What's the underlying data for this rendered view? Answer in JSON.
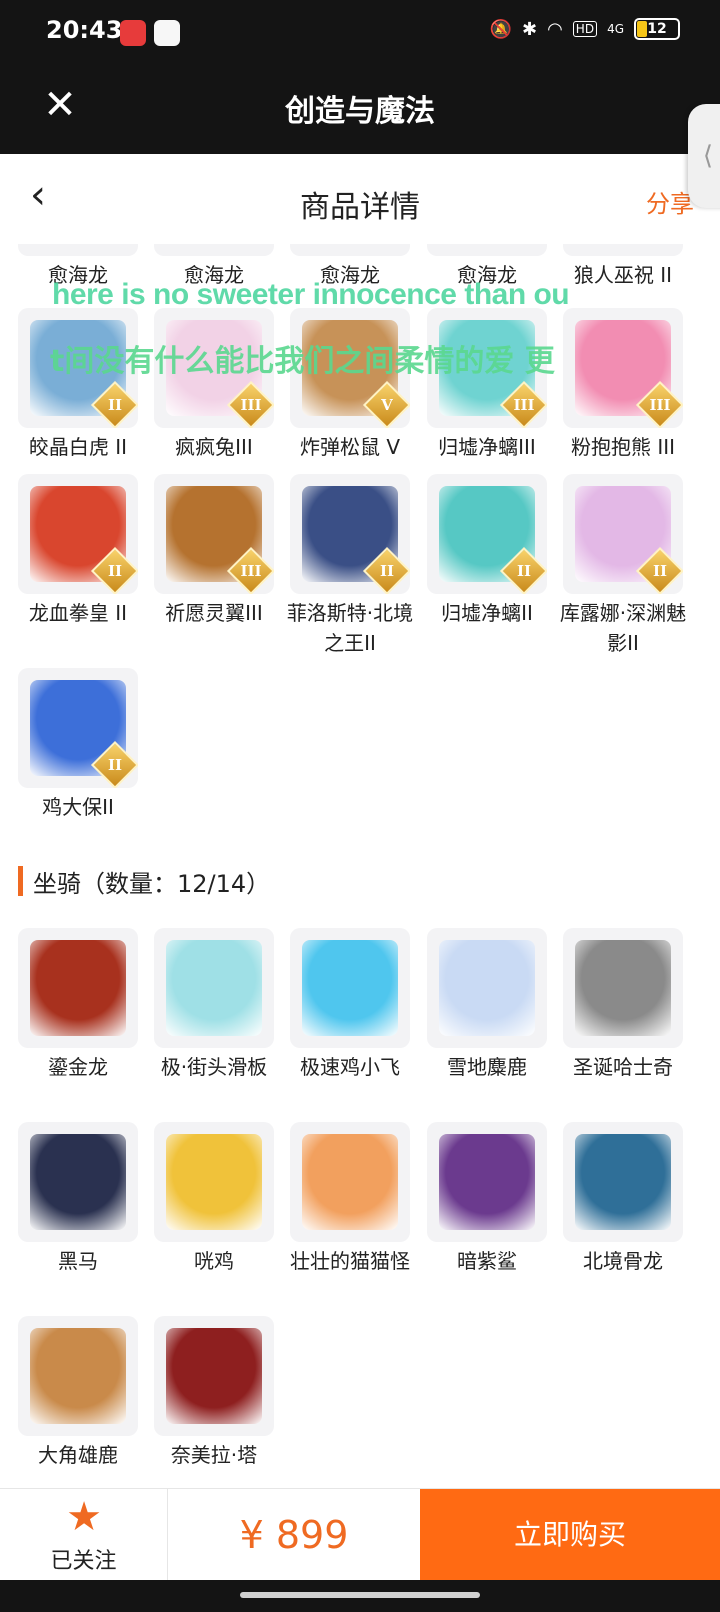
{
  "status_bar": {
    "time": "20:43",
    "battery": "12",
    "network": "4G",
    "hd": "HD"
  },
  "webview": {
    "close_icon": "close-icon",
    "title": "创造与魔法"
  },
  "header": {
    "title": "商品详情",
    "share": "分享"
  },
  "overlay": {
    "line1": "here is no sweeter innocence than ou",
    "line2": "t间没有什么能比我们之间柔情的爱 更"
  },
  "pets": [
    {
      "name": "愈海龙",
      "color": "#7fc7ef",
      "badge": ""
    },
    {
      "name": "愈海龙",
      "color": "#7fc7ef",
      "badge": ""
    },
    {
      "name": "愈海龙",
      "color": "#7fc7ef",
      "badge": ""
    },
    {
      "name": "愈海龙",
      "color": "#7fc7ef",
      "badge": ""
    },
    {
      "name": "狼人巫祝 II",
      "color": "#6b4a2e",
      "badge": ""
    },
    {
      "name": "皎晶白虎 II",
      "color": "#7aaed6",
      "badge": "II"
    },
    {
      "name": "疯疯兔III",
      "color": "#f2d2e6",
      "badge": "III"
    },
    {
      "name": "炸弹松鼠 V",
      "color": "#c79258",
      "badge": "V"
    },
    {
      "name": "归墟净螭III",
      "color": "#6fd3d1",
      "badge": "III"
    },
    {
      "name": "粉抱抱熊 III",
      "color": "#f28db2",
      "badge": "III"
    },
    {
      "name": "龙血拳皇 II",
      "color": "#d9462e",
      "badge": "II"
    },
    {
      "name": "祈愿灵翼III",
      "color": "#b5722f",
      "badge": "III"
    },
    {
      "name": "菲洛斯特·北境之王II",
      "color": "#3a4f86",
      "badge": "II"
    },
    {
      "name": "归墟净螭II",
      "color": "#56c8c4",
      "badge": "II"
    },
    {
      "name": "库露娜·深渊魅影II",
      "color": "#e3b8e6",
      "badge": "II"
    },
    {
      "name": "鸡大保II",
      "color": "#3d6fd9",
      "badge": "II"
    }
  ],
  "mounts_section": {
    "title": "坐骑（数量：12/14）"
  },
  "mounts": [
    {
      "name": "鎏金龙",
      "color": "#a8311e"
    },
    {
      "name": "极·街头滑板",
      "color": "#9fe0e6"
    },
    {
      "name": "极速鸡小飞",
      "color": "#4fc6ee"
    },
    {
      "name": "雪地麋鹿",
      "color": "#c9daf4"
    },
    {
      "name": "圣诞哈士奇",
      "color": "#8a8a8a"
    },
    {
      "name": "黑马",
      "color": "#2a3150"
    },
    {
      "name": "咣鸡",
      "color": "#f0c23a"
    },
    {
      "name": "壮壮的猫猫怪",
      "color": "#f2a05e"
    },
    {
      "name": "暗紫鲨",
      "color": "#6b3a8e"
    },
    {
      "name": "北境骨龙",
      "color": "#2f6f98"
    },
    {
      "name": "大角雄鹿",
      "color": "#c98a4a"
    },
    {
      "name": "奈美拉·塔",
      "color": "#8e1f1f"
    }
  ],
  "bottom": {
    "follow_icon": "star-icon",
    "follow": "已关注",
    "price": "¥ 899",
    "buy": "立即购买"
  },
  "colors": {
    "accent": "#ef6a22",
    "buy_button": "#ff6a13"
  }
}
